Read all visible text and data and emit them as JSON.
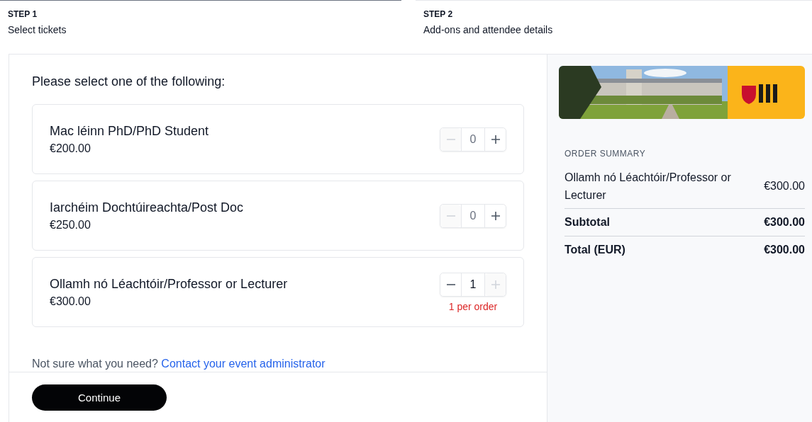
{
  "steps": [
    {
      "label": "STEP 1",
      "title": "Select tickets",
      "selected": true
    },
    {
      "label": "STEP 2",
      "title": "Add-ons and attendee details",
      "selected": false
    }
  ],
  "heading": "Please select one of the following:",
  "tickets": [
    {
      "name": "Mac léinn PhD/PhD Student",
      "price": "€200.00",
      "quantity": "0",
      "minus_disabled": true,
      "plus_disabled": false
    },
    {
      "name": "Iarchéim Dochtúireachta/Post Doc",
      "price": "€250.00",
      "quantity": "0",
      "minus_disabled": true,
      "plus_disabled": false
    },
    {
      "name": "Ollamh nó Léachtóir/Professor or Lecturer",
      "price": "€300.00",
      "quantity": "1",
      "minus_disabled": false,
      "plus_disabled": true,
      "note": "1 per order"
    }
  ],
  "help": {
    "text": "Not sure what you need?",
    "link": "Contact your event administrator"
  },
  "continue_button": "Continue",
  "summary": {
    "title": "ORDER SUMMARY",
    "lines": [
      {
        "kind": "item",
        "label": "Ollamh nó Léachtóir/Professor or Lecturer",
        "amount": "€300.00"
      },
      {
        "kind": "total",
        "label": "Subtotal",
        "amount": "€300.00"
      },
      {
        "kind": "total",
        "label": "Total (EUR)",
        "amount": "€300.00"
      }
    ]
  }
}
